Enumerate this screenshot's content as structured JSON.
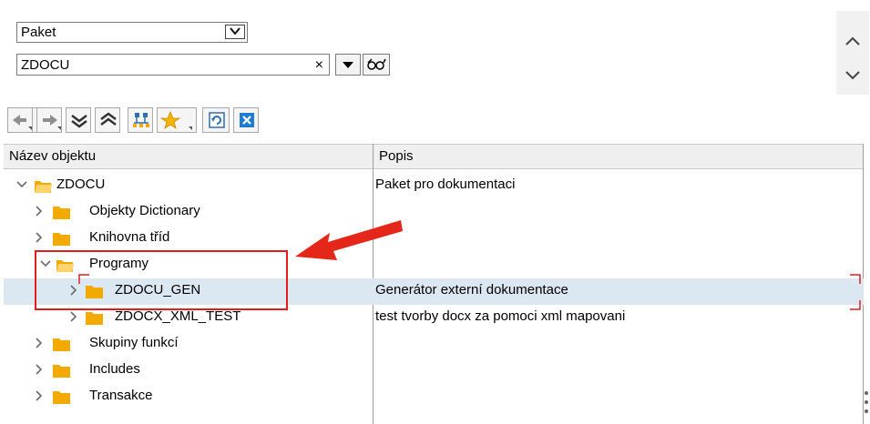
{
  "object_type_select": {
    "value": "Paket"
  },
  "object_name_input": {
    "value": "ZDOCU",
    "clear_glyph": "×"
  },
  "buttons": {
    "dropdown": "dropdown-arrow-icon",
    "display": "glasses-icon"
  },
  "scroll": {
    "up": "chevron-up-icon",
    "down": "chevron-down-icon"
  },
  "toolbar": [
    "back-icon",
    "forward-icon",
    "collapse-all-icon",
    "expand-all-icon",
    "hierarchy-icon",
    "favorites-icon",
    "refresh-icon",
    "close-icon"
  ],
  "columns": {
    "name": "Název objektu",
    "desc": "Popis"
  },
  "tree": [
    {
      "name": "ZDOCU",
      "desc": "Paket pro dokumentaci",
      "level": 0,
      "expanded": true
    },
    {
      "name": "Objekty Dictionary",
      "desc": "",
      "level": 1,
      "expanded": false
    },
    {
      "name": "Knihovna tříd",
      "desc": "",
      "level": 1,
      "expanded": false
    },
    {
      "name": "Programy",
      "desc": "",
      "level": 1,
      "expanded": true
    },
    {
      "name": "ZDOCU_GEN",
      "desc": "Generátor externí dokumentace",
      "level": 2,
      "expanded": false,
      "selected": true
    },
    {
      "name": "ZDOCX_XML_TEST",
      "desc": "test tvorby docx za pomoci xml mapovani",
      "level": 2,
      "expanded": false
    },
    {
      "name": "Skupiny funkcí",
      "desc": "",
      "level": 1,
      "expanded": false
    },
    {
      "name": "Includes",
      "desc": "",
      "level": 1,
      "expanded": false
    },
    {
      "name": "Transakce",
      "desc": "",
      "level": 1,
      "expanded": false
    }
  ],
  "colors": {
    "folder": "#f2a900",
    "folder_light": "#ffd36b",
    "selection": "#dbe8f1",
    "highlight": "#e11d1d"
  }
}
